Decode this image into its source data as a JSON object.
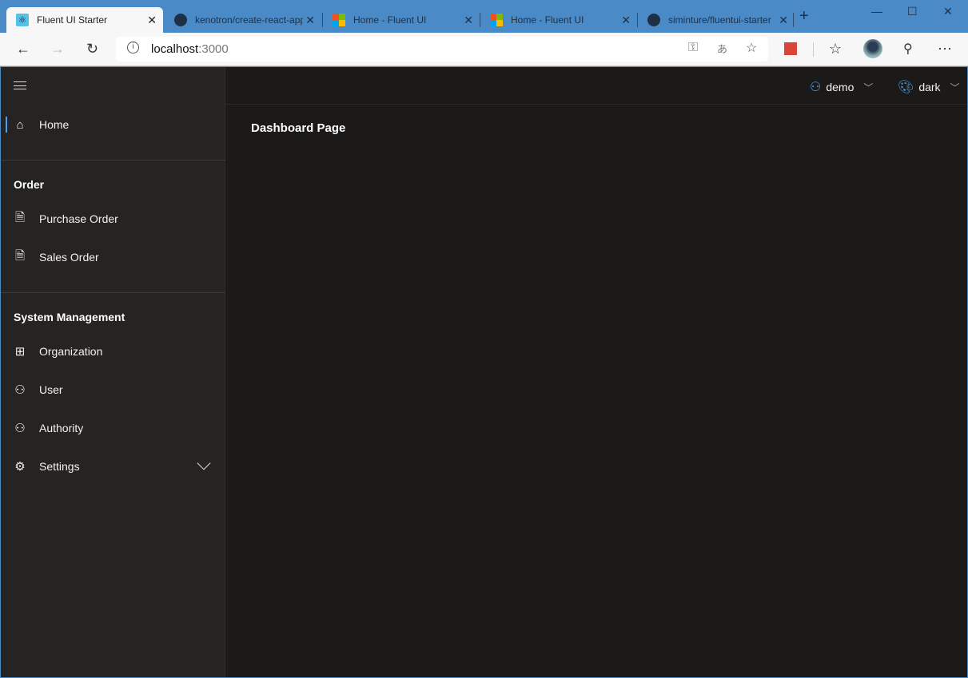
{
  "browser": {
    "tabs": [
      {
        "title": "Fluent UI Starter",
        "icon": "react-icon",
        "active": true
      },
      {
        "title": "kenotron/create-react-app",
        "icon": "github-icon"
      },
      {
        "title": "Home - Fluent UI",
        "icon": "microsoft-icon"
      },
      {
        "title": "Home - Fluent UI",
        "icon": "microsoft-icon"
      },
      {
        "title": "siminture/fluentui-starter",
        "icon": "github-icon"
      }
    ],
    "address": {
      "host": "localhost",
      "port": ":3000"
    }
  },
  "sidebar": {
    "home": "Home",
    "groups": [
      {
        "title": "Order",
        "items": [
          "Purchase Order",
          "Sales Order"
        ]
      },
      {
        "title": "System Management",
        "items": [
          "Organization",
          "User",
          "Authority",
          "Settings"
        ]
      }
    ]
  },
  "header": {
    "user": "demo",
    "theme": "dark"
  },
  "main": {
    "title": "Dashboard Page"
  },
  "colors": {
    "accent": "#479ef5",
    "sidebar": "#252423",
    "content": "#1b1a19"
  }
}
